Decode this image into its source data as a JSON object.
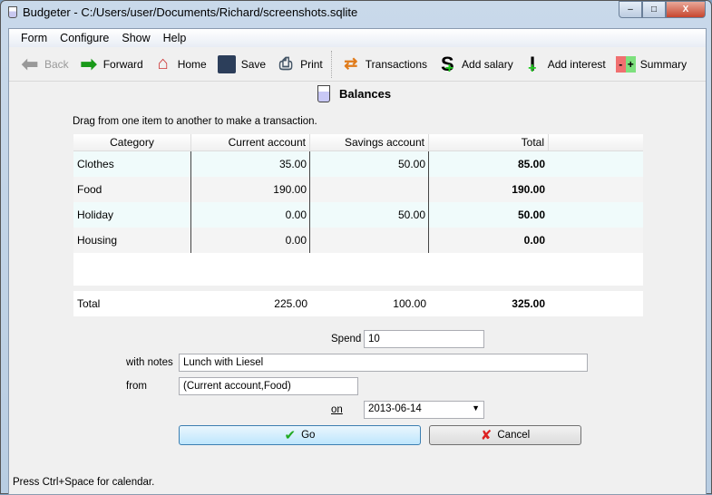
{
  "window": {
    "title": "Budgeter - C:/Users/user/Documents/Richard/screenshots.sqlite",
    "minimize": "–",
    "maximize": "□",
    "close": "X"
  },
  "menu": [
    {
      "label": "Form"
    },
    {
      "label": "Configure"
    },
    {
      "label": "Show"
    },
    {
      "label": "Help"
    }
  ],
  "toolbar": {
    "back": "Back",
    "forward": "Forward",
    "home": "Home",
    "save": "Save",
    "print": "Print",
    "transactions": "Transactions",
    "add_salary": "Add salary",
    "add_interest": "Add interest",
    "summary": "Summary"
  },
  "page": {
    "heading": "Balances",
    "hint": "Drag from one item to another to make a transaction."
  },
  "table": {
    "columns": [
      "Category",
      "Current account",
      "Savings account",
      "Total"
    ],
    "rows": [
      [
        "Clothes",
        "35.00",
        "50.00",
        "85.00"
      ],
      [
        "Food",
        "190.00",
        "",
        "190.00"
      ],
      [
        "Holiday",
        "0.00",
        "50.00",
        "50.00"
      ],
      [
        "Housing",
        "0.00",
        "",
        "0.00"
      ]
    ],
    "totals": [
      "Total",
      "225.00",
      "100.00",
      "325.00"
    ]
  },
  "form": {
    "action_label": "Spend",
    "amount": "10",
    "notes_label": "with notes",
    "notes": "Lunch with Liesel",
    "from_label": "from",
    "from": "(Current account,Food)",
    "on_label": "on",
    "date": "2013-06-14",
    "go": "Go",
    "cancel": "Cancel"
  },
  "status": "Press Ctrl+Space for calendar."
}
